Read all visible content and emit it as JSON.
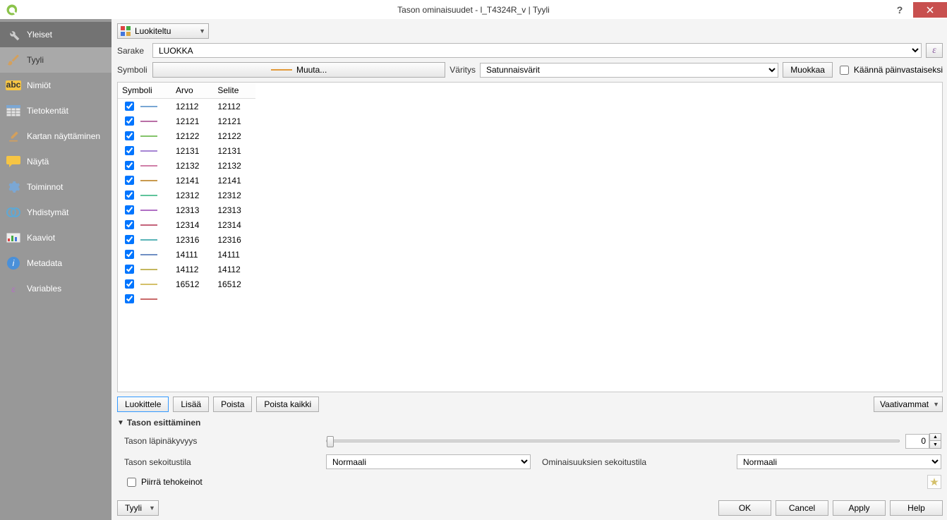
{
  "window": {
    "title": "Tason ominaisuudet - l_T4324R_v | Tyyli"
  },
  "sidebar": {
    "items": [
      {
        "label": "Yleiset"
      },
      {
        "label": "Tyyli"
      },
      {
        "label": "Nimiöt"
      },
      {
        "label": "Tietokentät"
      },
      {
        "label": "Kartan näyttäminen"
      },
      {
        "label": "Näytä"
      },
      {
        "label": "Toiminnot"
      },
      {
        "label": "Yhdistymät"
      },
      {
        "label": "Kaaviot"
      },
      {
        "label": "Metadata"
      },
      {
        "label": "Variables"
      }
    ]
  },
  "style": {
    "renderer": "Luokiteltu",
    "column_label": "Sarake",
    "column_value": "LUOKKA",
    "symbol_label": "Symboli",
    "symbol_change": "Muuta...",
    "color_label": "Väritys",
    "color_value": "Satunnaisvärit",
    "edit_button": "Muokkaa",
    "invert_label": "Käännä päinvastaiseksi",
    "headers": {
      "symbol": "Symboli",
      "value": "Arvo",
      "legend": "Selite"
    },
    "rows": [
      {
        "checked": true,
        "color": "#79a7d4",
        "value": "12112",
        "legend": "12112"
      },
      {
        "checked": true,
        "color": "#b96fa6",
        "value": "12121",
        "legend": "12121"
      },
      {
        "checked": true,
        "color": "#84c46a",
        "value": "12122",
        "legend": "12122"
      },
      {
        "checked": true,
        "color": "#a584d4",
        "value": "12131",
        "legend": "12131"
      },
      {
        "checked": true,
        "color": "#d07fa8",
        "value": "12132",
        "legend": "12132"
      },
      {
        "checked": true,
        "color": "#c99a4e",
        "value": "12141",
        "legend": "12141"
      },
      {
        "checked": true,
        "color": "#5fc49b",
        "value": "12312",
        "legend": "12312"
      },
      {
        "checked": true,
        "color": "#b06fc4",
        "value": "12313",
        "legend": "12313"
      },
      {
        "checked": true,
        "color": "#c4627a",
        "value": "12314",
        "legend": "12314"
      },
      {
        "checked": true,
        "color": "#5ab4b7",
        "value": "12316",
        "legend": "12316"
      },
      {
        "checked": true,
        "color": "#6f8fc4",
        "value": "14111",
        "legend": "14111"
      },
      {
        "checked": true,
        "color": "#c4b75f",
        "value": "14112",
        "legend": "14112"
      },
      {
        "checked": true,
        "color": "#d4c06a",
        "value": "16512",
        "legend": "16512"
      },
      {
        "checked": true,
        "color": "#c96a6a",
        "value": "",
        "legend": ""
      }
    ],
    "buttons": {
      "classify": "Luokittele",
      "add": "Lisää",
      "delete": "Poista",
      "delete_all": "Poista kaikki",
      "advanced": "Vaativammat"
    }
  },
  "rendering": {
    "section": "Tason esittäminen",
    "opacity_label": "Tason läpinäkyvyys",
    "opacity_value": "0",
    "blend_label": "Tason sekoitustila",
    "blend_value": "Normaali",
    "feature_blend_label": "Ominaisuuksien sekoitustila",
    "feature_blend_value": "Normaali",
    "draw_effects": "Piirrä tehokeinot"
  },
  "footer": {
    "style": "Tyyli",
    "ok": "OK",
    "cancel": "Cancel",
    "apply": "Apply",
    "help": "Help"
  }
}
